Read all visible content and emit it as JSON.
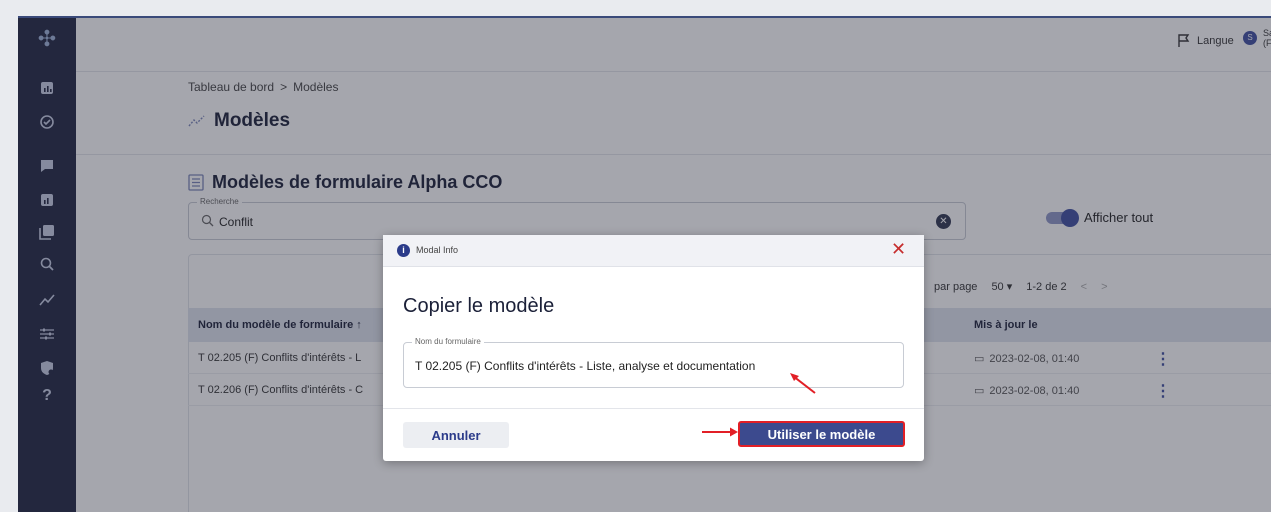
{
  "topbar": {
    "language_label": "Langue",
    "user_initial": "S",
    "user_name": "Sarah",
    "user_role": "(Formation)"
  },
  "breadcrumb": {
    "home": "Tableau de bord",
    "separator": ">",
    "current": "Modèles"
  },
  "page_title": "Modèles",
  "section_title": "Modèles de formulaire Alpha CCO",
  "search": {
    "legend": "Recherche",
    "value": "Conflit"
  },
  "toggle_label": "Afficher tout",
  "pager": {
    "per_page_label": "par page",
    "per_page_value": "50",
    "range": "1-2 de 2",
    "prev": "<",
    "next": ">"
  },
  "table": {
    "headers": [
      "Nom du modèle de formulaire",
      "Mis à jour le"
    ],
    "rows": [
      {
        "name": "T 02.205 (F) Conflits d'intérêts - L",
        "updated": "2023-02-08, 01:40"
      },
      {
        "name": "T 02.206 (F) Conflits d'intérêts - C",
        "updated": "2023-02-08, 01:40"
      }
    ]
  },
  "modal": {
    "header_label": "Modal Info",
    "title": "Copier le modèle",
    "field_legend": "Nom du formulaire",
    "field_value": "T 02.205 (F) Conflits d'intérêts - Liste, analyse et documentation",
    "cancel_label": "Annuler",
    "confirm_label": "Utiliser le modèle"
  },
  "colors": {
    "sidebar": "#1f2540",
    "accent": "#3c4a8e",
    "annotation": "#e21f26",
    "close": "#c62d2d"
  }
}
